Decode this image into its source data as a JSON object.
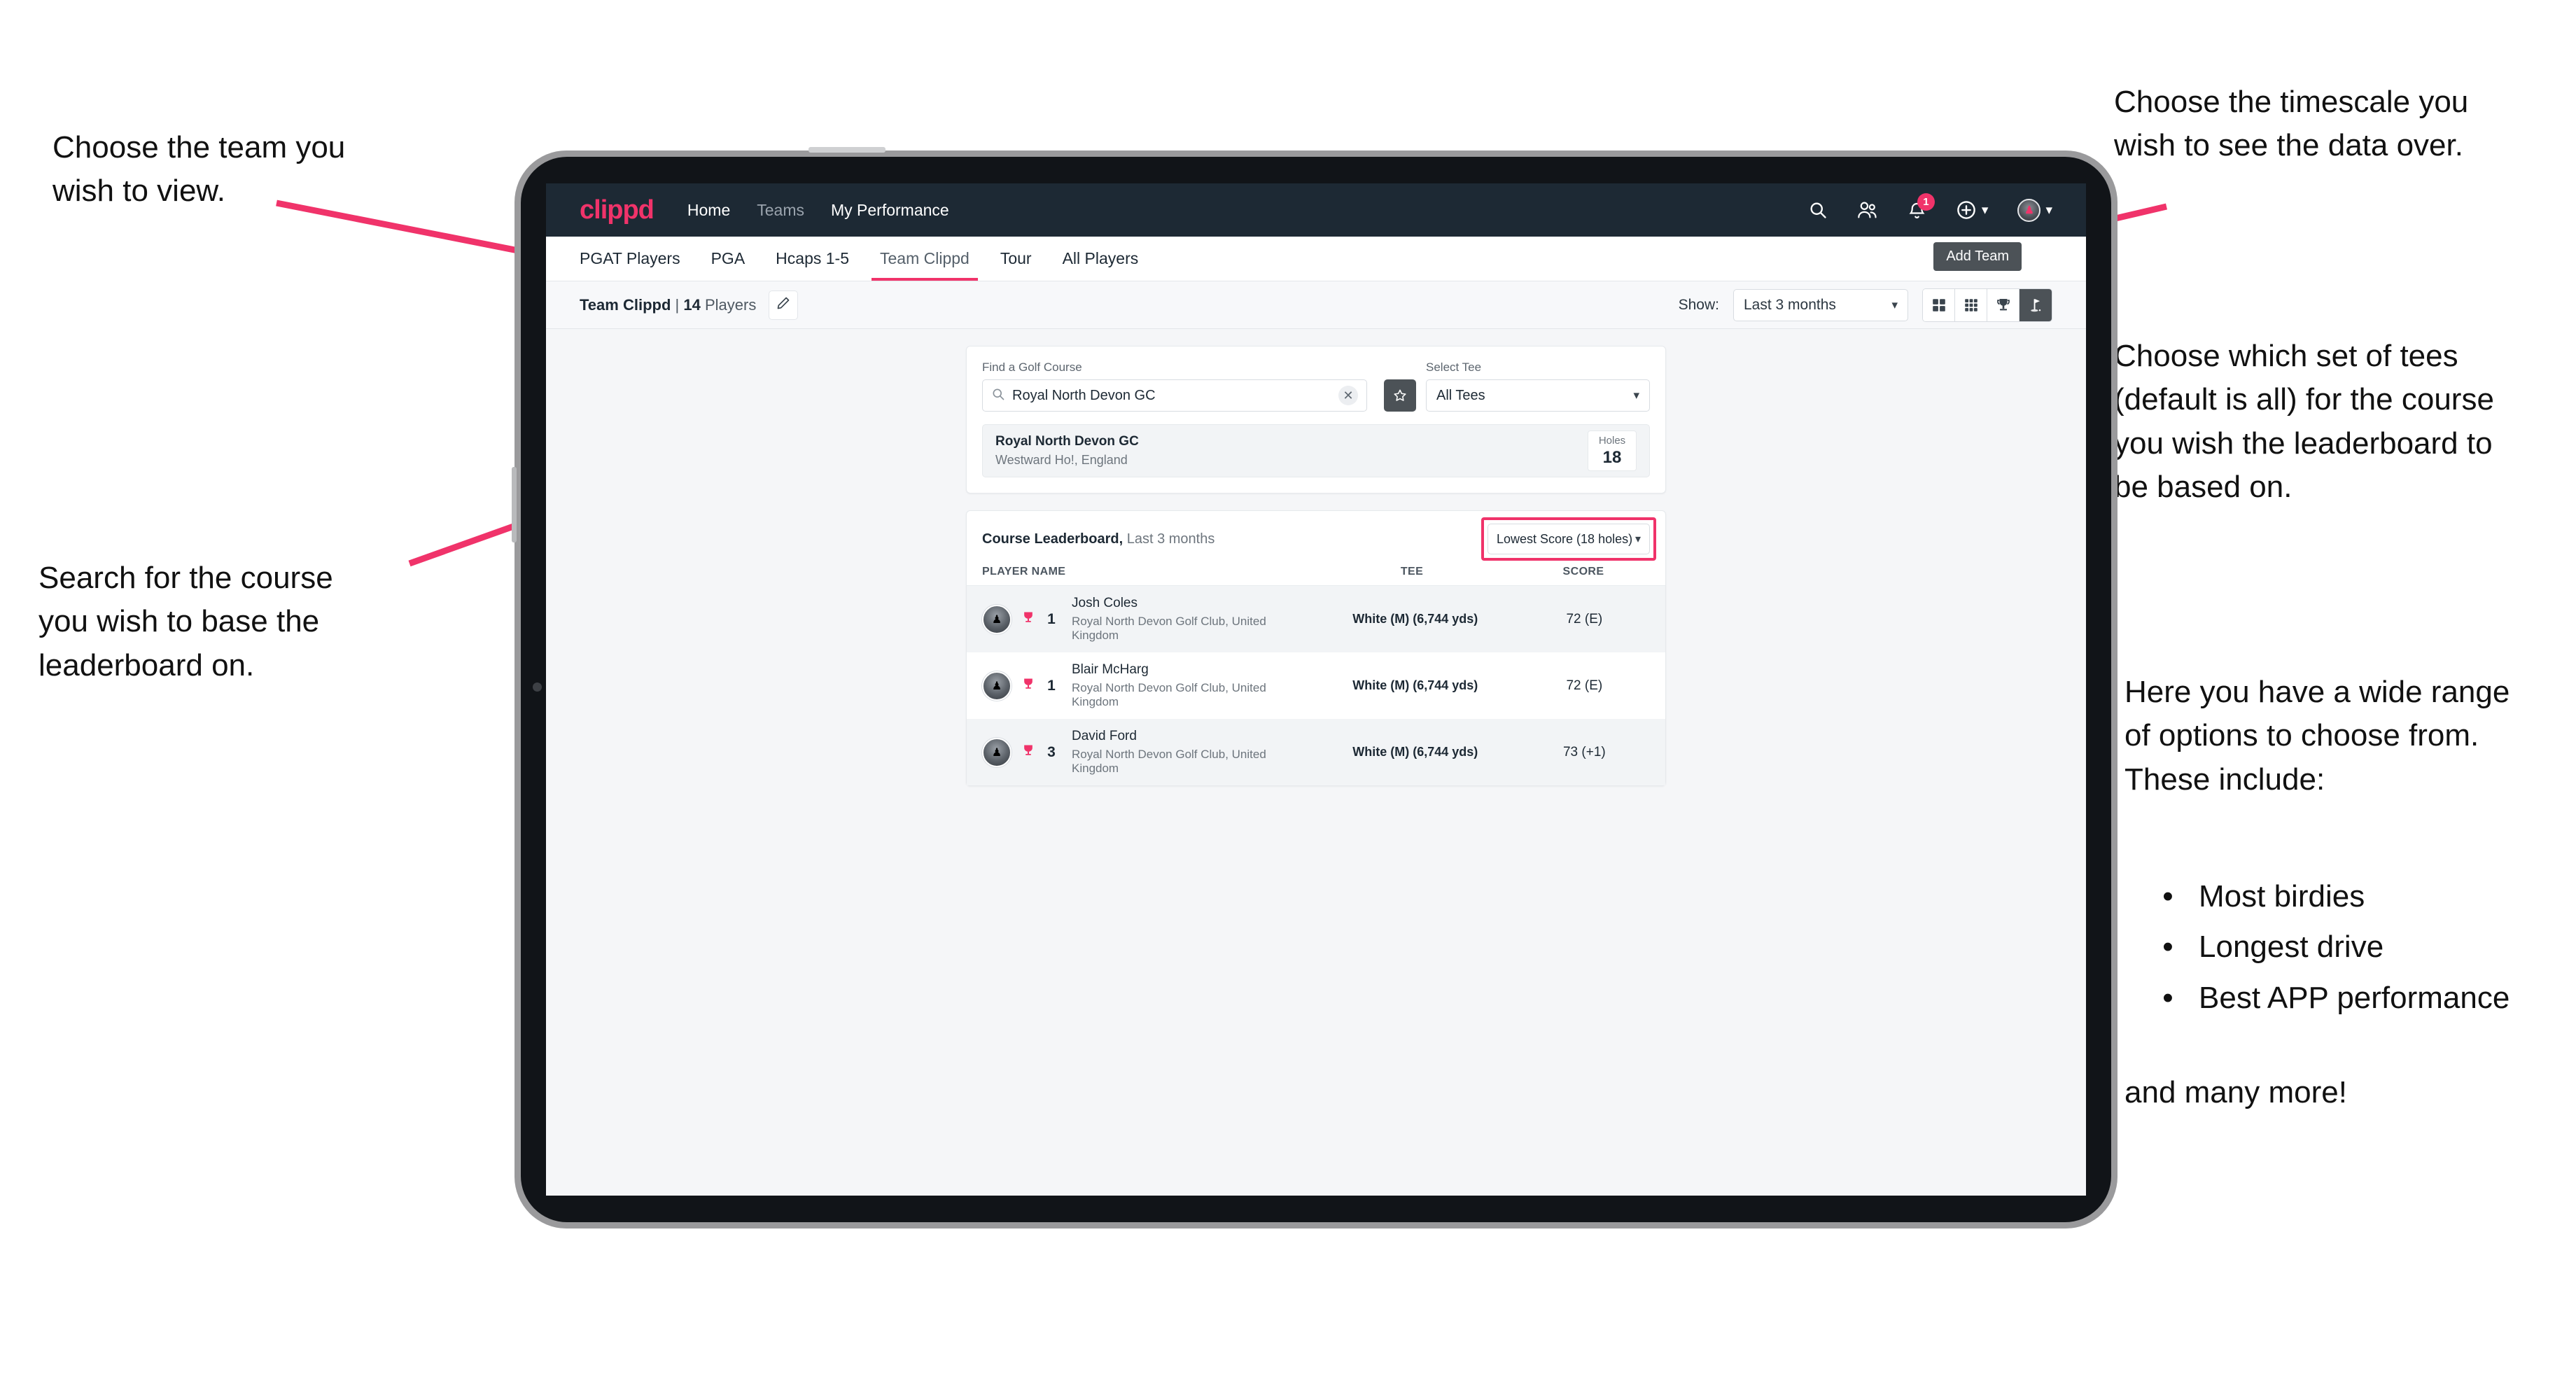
{
  "annotations": {
    "team": "Choose the team you\nwish to view.",
    "timescale": "Choose the timescale you\nwish to see the data over.",
    "tees": "Choose which set of tees\n(default is all) for the course\nyou wish the leaderboard to\nbe based on.",
    "search": "Search for the course\nyou wish to base the\nleaderboard on.",
    "options_intro": "Here you have a wide range\nof options to choose from.\nThese include:",
    "options_bullets": [
      "Most birdies",
      "Longest drive",
      "Best APP performance"
    ],
    "options_outro": "and many more!",
    "bullet_char": "•",
    "accent": "#f0336a"
  },
  "app": {
    "logo": "clippd",
    "nav": [
      {
        "label": "Home",
        "active": true
      },
      {
        "label": "Teams",
        "active": false
      },
      {
        "label": "My Performance",
        "active": true
      }
    ],
    "icons": {
      "search": "search-icon",
      "people": "people-icon",
      "bell": "bell-icon",
      "plus": "plus-circle-icon",
      "avatar": "avatar-icon"
    },
    "notification_count": "1",
    "tooltip": "Add Team"
  },
  "tabs": [
    {
      "label": "PGAT Players",
      "state": "normal"
    },
    {
      "label": "PGA",
      "state": "normal"
    },
    {
      "label": "Hcaps 1-5",
      "state": "normal"
    },
    {
      "label": "Team Clippd",
      "state": "active"
    },
    {
      "label": "Tour",
      "state": "normal"
    },
    {
      "label": "All Players",
      "state": "normal"
    }
  ],
  "toolbar": {
    "team_name": "Team Clippd",
    "separator": "|",
    "player_count": "14",
    "players_word": "Players",
    "edit_icon": "pencil-icon",
    "show_label": "Show:",
    "show_value": "Last 3 months",
    "views": [
      {
        "name": "grid-2x2-view",
        "active": false
      },
      {
        "name": "grid-3x3-view",
        "active": false
      },
      {
        "name": "trophy-view",
        "active": false
      },
      {
        "name": "golf-flag-view",
        "active": true
      }
    ]
  },
  "search_card": {
    "course_label": "Find a Golf Course",
    "course_value": "Royal North Devon GC",
    "course_placeholder": "Find a Golf Course",
    "clear_symbol": "✕",
    "star_symbol": "☆",
    "tee_label": "Select Tee",
    "tee_value": "All Tees"
  },
  "course_result": {
    "name": "Royal North Devon GC",
    "location": "Westward Ho!, England",
    "holes_label": "Holes",
    "holes_value": "18"
  },
  "leaderboard": {
    "title": "Course Leaderboard,",
    "subtitle": "Last 3 months",
    "sort_value": "Lowest Score (18 holes)",
    "columns": {
      "name": "PLAYER NAME",
      "tee": "TEE",
      "score": "SCORE"
    },
    "rows": [
      {
        "rank": "1",
        "name": "Josh Coles",
        "club": "Royal North Devon Golf Club, United Kingdom",
        "tee": "White (M) (6,744 yds)",
        "score": "72 (E)"
      },
      {
        "rank": "1",
        "name": "Blair McHarg",
        "club": "Royal North Devon Golf Club, United Kingdom",
        "tee": "White (M) (6,744 yds)",
        "score": "72 (E)"
      },
      {
        "rank": "3",
        "name": "David Ford",
        "club": "Royal North Devon Golf Club, United Kingdom",
        "tee": "White (M) (6,744 yds)",
        "score": "73 (+1)"
      }
    ]
  }
}
